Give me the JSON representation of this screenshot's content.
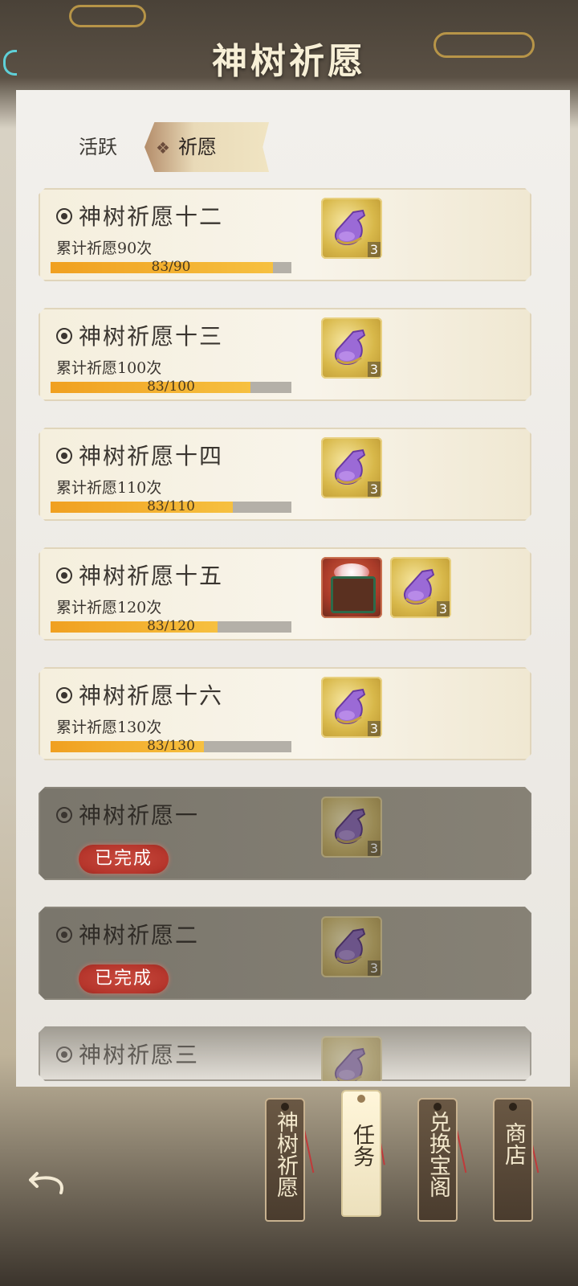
{
  "header": {
    "title": "神树祈愿"
  },
  "tabs": [
    {
      "label": "活跃",
      "active": false
    },
    {
      "label": "祈愿",
      "active": true
    }
  ],
  "tasks": [
    {
      "title": "神树祈愿十二",
      "subtitle": "累计祈愿90次",
      "progress_text": "83/90",
      "progress": 0.922,
      "rewards": [
        {
          "icon": "purple-bottle-icon",
          "qty": "3"
        }
      ]
    },
    {
      "title": "神树祈愿十三",
      "subtitle": "累计祈愿100次",
      "progress_text": "83/100",
      "progress": 0.83,
      "rewards": [
        {
          "icon": "purple-bottle-icon",
          "qty": "3"
        }
      ]
    },
    {
      "title": "神树祈愿十四",
      "subtitle": "累计祈愿110次",
      "progress_text": "83/110",
      "progress": 0.755,
      "rewards": [
        {
          "icon": "purple-bottle-icon",
          "qty": "3"
        }
      ]
    },
    {
      "title": "神树祈愿十五",
      "subtitle": "累计祈愿120次",
      "progress_text": "83/120",
      "progress": 0.692,
      "rewards": [
        {
          "icon": "flower-chest-icon",
          "qty": ""
        },
        {
          "icon": "purple-bottle-icon",
          "qty": "3"
        }
      ]
    },
    {
      "title": "神树祈愿十六",
      "subtitle": "累计祈愿130次",
      "progress_text": "83/130",
      "progress": 0.638,
      "rewards": [
        {
          "icon": "purple-bottle-icon",
          "qty": "3"
        }
      ]
    },
    {
      "title": "神树祈愿一",
      "status": "已完成",
      "rewards": [
        {
          "icon": "purple-bottle-icon",
          "qty": "3"
        }
      ]
    },
    {
      "title": "神树祈愿二",
      "status": "已完成",
      "rewards": [
        {
          "icon": "purple-bottle-icon",
          "qty": "3"
        }
      ]
    },
    {
      "title": "神树祈愿三",
      "rewards": [
        {
          "icon": "purple-bottle-icon",
          "qty": ""
        }
      ]
    }
  ],
  "bottom_nav": [
    {
      "label": "神树祈愿",
      "active": false
    },
    {
      "label": "任务",
      "active": true
    },
    {
      "label": "兑换宝阁",
      "active": false
    },
    {
      "label": "商店",
      "active": false
    }
  ],
  "colors": {
    "progress_fill": "#f0a020",
    "done_badge": "#b6362c",
    "tag_active_bg": "#fff6da"
  }
}
